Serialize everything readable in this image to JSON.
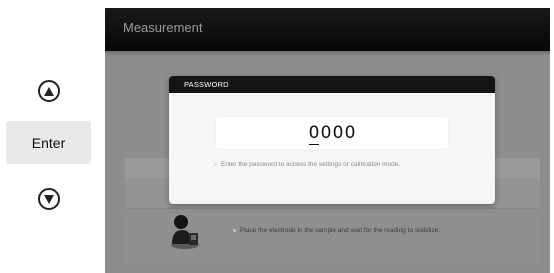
{
  "controls": {
    "up_icon": "triangle-up-icon",
    "enter_label": "Enter",
    "down_icon": "triangle-down-icon"
  },
  "screen": {
    "title": "Measurement",
    "instruction": "Place the electrode in the sample and wait for the reading to stabilize."
  },
  "dialog": {
    "title": "PASSWORD",
    "digits": [
      "0",
      "0",
      "0",
      "0"
    ],
    "hint": "Enter the password to access the settings or calibration mode."
  }
}
